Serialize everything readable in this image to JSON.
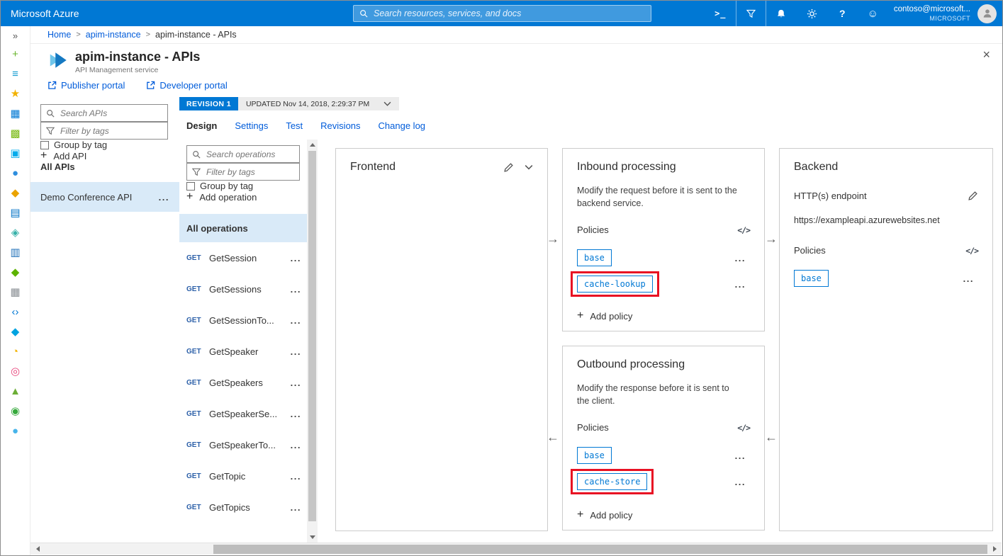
{
  "topbar": {
    "brand": "Microsoft Azure",
    "search_placeholder": "Search resources, services, and docs",
    "account": {
      "email": "contoso@microsoft...",
      "org": "MICROSOFT"
    }
  },
  "breadcrumb": {
    "items": [
      "Home",
      "apim-instance",
      "apim-instance - APIs"
    ]
  },
  "page": {
    "title": "apim-instance - APIs",
    "subtitle": "API Management service",
    "portal_links": [
      "Publisher portal",
      "Developer portal"
    ]
  },
  "api_panel": {
    "search_placeholder": "Search APIs",
    "filter_placeholder": "Filter by tags",
    "group_by_tag_label": "Group by tag",
    "add_api_label": "Add API",
    "all_apis_label": "All APIs",
    "apis": [
      {
        "name": "Demo Conference API",
        "selected": true
      }
    ]
  },
  "revision": {
    "badge": "REVISION 1",
    "updated": "UPDATED Nov 14, 2018, 2:29:37 PM"
  },
  "tabs": [
    "Design",
    "Settings",
    "Test",
    "Revisions",
    "Change log"
  ],
  "active_tab": "Design",
  "operations_panel": {
    "search_placeholder": "Search operations",
    "filter_placeholder": "Filter by tags",
    "group_by_tag_label": "Group by tag",
    "add_operation_label": "Add operation",
    "all_operations_label": "All operations",
    "operations": [
      {
        "verb": "GET",
        "name": "GetSession"
      },
      {
        "verb": "GET",
        "name": "GetSessions"
      },
      {
        "verb": "GET",
        "name": "GetSessionTo..."
      },
      {
        "verb": "GET",
        "name": "GetSpeaker"
      },
      {
        "verb": "GET",
        "name": "GetSpeakers"
      },
      {
        "verb": "GET",
        "name": "GetSpeakerSe..."
      },
      {
        "verb": "GET",
        "name": "GetSpeakerTo..."
      },
      {
        "verb": "GET",
        "name": "GetTopic"
      },
      {
        "verb": "GET",
        "name": "GetTopics"
      }
    ]
  },
  "designer": {
    "frontend": {
      "title": "Frontend"
    },
    "inbound": {
      "title": "Inbound processing",
      "description": "Modify the request before it is sent to the backend service.",
      "policies_label": "Policies",
      "policies": [
        {
          "name": "base",
          "highlighted": false
        },
        {
          "name": "cache-lookup",
          "highlighted": true
        }
      ],
      "add_policy_label": "Add policy"
    },
    "outbound": {
      "title": "Outbound processing",
      "description": "Modify the response before it is sent to the client.",
      "policies_label": "Policies",
      "policies": [
        {
          "name": "base",
          "highlighted": false
        },
        {
          "name": "cache-store",
          "highlighted": true
        }
      ],
      "add_policy_label": "Add policy"
    },
    "backend": {
      "title": "Backend",
      "endpoint_label": "HTTP(s) endpoint",
      "endpoint_url": "https://exampleapi.azurewebsites.net",
      "policies_label": "Policies",
      "policies": [
        {
          "name": "base",
          "highlighted": false
        }
      ]
    }
  },
  "left_rail": {
    "expand_icon": "»",
    "icons": [
      {
        "name": "create-resource-icon",
        "glyph": "+",
        "color": "#69b42c"
      },
      {
        "name": "all-services-icon",
        "glyph": "≡",
        "color": "#139bd0"
      },
      {
        "name": "favorites-icon",
        "glyph": "★",
        "color": "#f2b200"
      },
      {
        "name": "dashboard-icon",
        "glyph": "▦",
        "color": "#0078d4"
      },
      {
        "name": "all-resources-icon",
        "glyph": "▩",
        "color": "#76b80e"
      },
      {
        "name": "resource-groups-icon",
        "glyph": "▣",
        "color": "#00abec"
      },
      {
        "name": "app-services-icon",
        "glyph": "●",
        "color": "#2e8ede"
      },
      {
        "name": "function-apps-icon",
        "glyph": "◆",
        "color": "#eaa300"
      },
      {
        "name": "sql-databases-icon",
        "glyph": "▤",
        "color": "#0072c6"
      },
      {
        "name": "cosmos-db-icon",
        "glyph": "◈",
        "color": "#36b0a8"
      },
      {
        "name": "virtual-machines-icon",
        "glyph": "▥",
        "color": "#2272b9"
      },
      {
        "name": "load-balancers-icon",
        "glyph": "◆",
        "color": "#5db300"
      },
      {
        "name": "storage-accounts-icon",
        "glyph": "▦",
        "color": "#8a8f94"
      },
      {
        "name": "virtual-networks-icon",
        "glyph": "‹›",
        "color": "#0078d4"
      },
      {
        "name": "azure-ad-icon",
        "glyph": "◆",
        "color": "#00a3e0"
      },
      {
        "name": "monitor-icon",
        "glyph": "◔",
        "color": "#f2b200"
      },
      {
        "name": "advisor-icon",
        "glyph": "◎",
        "color": "#e8467c"
      },
      {
        "name": "security-center-icon",
        "glyph": "▲",
        "color": "#6cae36"
      },
      {
        "name": "cost-management-icon",
        "glyph": "◉",
        "color": "#36a93c"
      },
      {
        "name": "help-support-icon",
        "glyph": "●",
        "color": "#47b4ea"
      }
    ]
  },
  "icons": {
    "more": "...",
    "code": "</>",
    "plus": "+",
    "close": "×",
    "separator": ">",
    "arrow_right": "→",
    "arrow_left": "←",
    "shell": ">_",
    "help": "?",
    "smiley": "☺"
  },
  "colors": {
    "topbar_bg": "#0078d4",
    "accent": "#0078d4",
    "link": "#015cda",
    "selected_bg": "#d9eaf8",
    "highlight_red": "#e81123",
    "verb_blue": "#2b5fa8"
  }
}
